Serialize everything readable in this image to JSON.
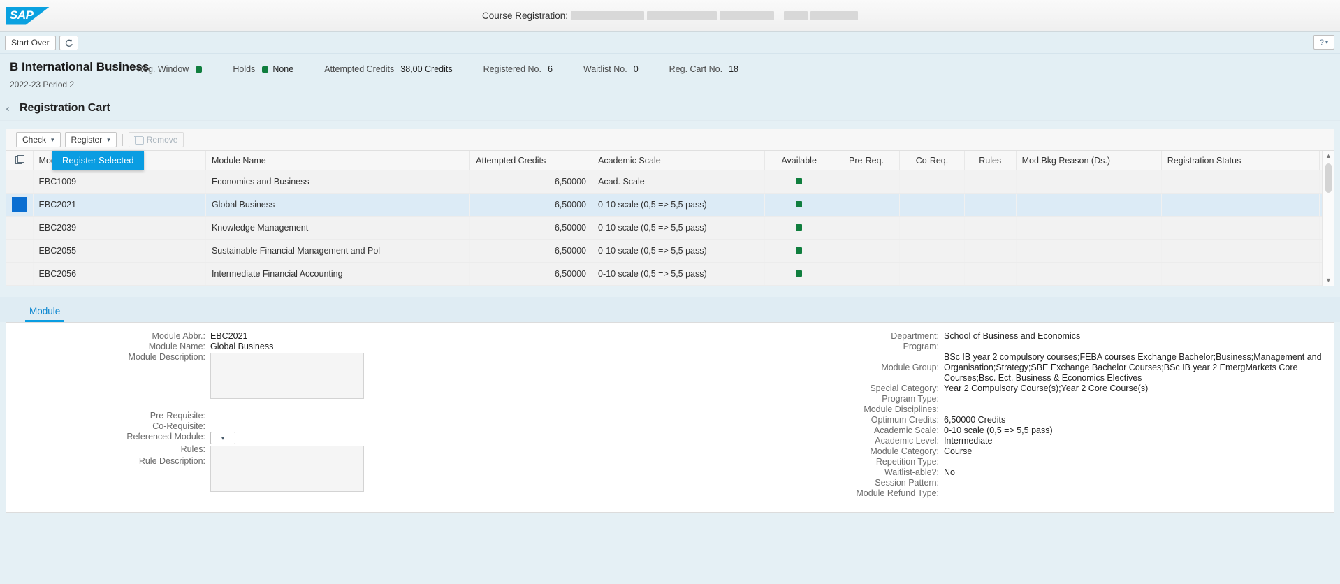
{
  "shell": {
    "logo_text": "SAP",
    "app_title": "Course Registration:",
    "help_icon": "question-mark-icon"
  },
  "actionbar": {
    "start_over": "Start Over",
    "refresh_icon": "refresh-icon"
  },
  "object_header": {
    "title": "B International Business",
    "subtitle": "2022-23 Period 2",
    "stats": [
      {
        "label": "Reg. Window",
        "value": "",
        "dot": true
      },
      {
        "label": "Holds",
        "value": "None",
        "dot": true
      },
      {
        "label": "Attempted Credits",
        "value": "38,00 Credits",
        "dot": false
      },
      {
        "label": "Registered No.",
        "value": "6",
        "dot": false
      },
      {
        "label": "Waitlist No.",
        "value": "0",
        "dot": false
      },
      {
        "label": "Reg. Cart No.",
        "value": "18",
        "dot": false
      }
    ],
    "status_color": "#107e3e"
  },
  "page": {
    "back_icon": "chevron-left-icon",
    "title": "Registration Cart"
  },
  "toolbar": {
    "check_label": "Check",
    "register_label": "Register",
    "remove_label": "Remove",
    "menu": {
      "open": true,
      "items": [
        "Register Selected"
      ],
      "highlight_color": "#0a9de2"
    }
  },
  "table": {
    "select_all_icon": "copy-icon",
    "columns": [
      "Module Abbr.",
      "Module Name",
      "Attempted Credits",
      "Academic Scale",
      "Available",
      "Pre-Req.",
      "Co-Req.",
      "Rules",
      "Mod.Bkg Reason (Ds.)",
      "Registration Status"
    ],
    "rows": [
      {
        "selected": false,
        "module_abbr": "EBC1009",
        "module_name": "Economics and Business",
        "attempted_credits": "6,50000",
        "academic_scale": "Acad. Scale",
        "available": true,
        "pre_req": "",
        "co_req": "",
        "rules": "",
        "mod_bkg_reason": "",
        "registration_status": ""
      },
      {
        "selected": true,
        "module_abbr": "EBC2021",
        "module_name": "Global Business",
        "attempted_credits": "6,50000",
        "academic_scale": "0-10 scale (0,5 => 5,5 pass)",
        "available": true,
        "pre_req": "",
        "co_req": "",
        "rules": "",
        "mod_bkg_reason": "",
        "registration_status": ""
      },
      {
        "selected": false,
        "module_abbr": "EBC2039",
        "module_name": "Knowledge Management",
        "attempted_credits": "6,50000",
        "academic_scale": "0-10 scale (0,5 => 5,5 pass)",
        "available": true,
        "pre_req": "",
        "co_req": "",
        "rules": "",
        "mod_bkg_reason": "",
        "registration_status": ""
      },
      {
        "selected": false,
        "module_abbr": "EBC2055",
        "module_name": "Sustainable Financial Management and Pol",
        "attempted_credits": "6,50000",
        "academic_scale": "0-10 scale (0,5 => 5,5 pass)",
        "available": true,
        "pre_req": "",
        "co_req": "",
        "rules": "",
        "mod_bkg_reason": "",
        "registration_status": ""
      },
      {
        "selected": false,
        "module_abbr": "EBC2056",
        "module_name": "Intermediate Financial Accounting",
        "attempted_credits": "6,50000",
        "academic_scale": "0-10 scale (0,5 => 5,5 pass)",
        "available": true,
        "pre_req": "",
        "co_req": "",
        "rules": "",
        "mod_bkg_reason": "",
        "registration_status": ""
      }
    ],
    "available_color": "#107e3e",
    "selected_row_color": "#dcebf6"
  },
  "detail": {
    "tabs": [
      {
        "label": "Module",
        "active": true
      }
    ],
    "left": {
      "module_abbr_label": "Module Abbr.:",
      "module_abbr_value": "EBC2021",
      "module_name_label": "Module Name:",
      "module_name_value": "Global Business",
      "module_description_label": "Module Description:",
      "module_description_value": "",
      "pre_requisite_label": "Pre-Requisite:",
      "pre_requisite_value": "",
      "co_requisite_label": "Co-Requisite:",
      "co_requisite_value": "",
      "referenced_module_label": "Referenced Module:",
      "referenced_module_value": "",
      "rules_label": "Rules:",
      "rules_value": "",
      "rule_description_label": "Rule Description:",
      "rule_description_value": ""
    },
    "right": {
      "department_label": "Department:",
      "department_value": "School of Business and Economics",
      "program_label": "Program:",
      "program_value": "",
      "module_group_label": "Module Group:",
      "module_group_line1": "BSc IB year 2 compulsory courses;FEBA courses Exchange Bachelor;Business;Management and",
      "module_group_line2": "Organisation;Strategy;SBE Exchange Bachelor Courses;BSc IB year 2 EmergMarkets Core",
      "module_group_line3": "Courses;Bsc. Ect. Business & Economics Electives",
      "special_category_label": "Special Category:",
      "special_category_value": "Year 2 Compulsory Course(s);Year 2 Core Course(s)",
      "program_type_label": "Program Type:",
      "program_type_value": "",
      "module_disciplines_label": "Module Disciplines:",
      "module_disciplines_value": "",
      "optimum_credits_label": "Optimum Credits:",
      "optimum_credits_value": "6,50000 Credits",
      "academic_scale_label": "Academic Scale:",
      "academic_scale_value": "0-10 scale (0,5 => 5,5 pass)",
      "academic_level_label": "Academic Level:",
      "academic_level_value": "Intermediate",
      "module_category_label": "Module Category:",
      "module_category_value": "Course",
      "repetition_type_label": "Repetition Type:",
      "repetition_type_value": "",
      "waitlist_able_label": "Waitlist-able?:",
      "waitlist_able_value": "No",
      "session_pattern_label": "Session Pattern:",
      "session_pattern_value": "",
      "module_refund_type_label": "Module Refund Type:",
      "module_refund_type_value": ""
    }
  }
}
